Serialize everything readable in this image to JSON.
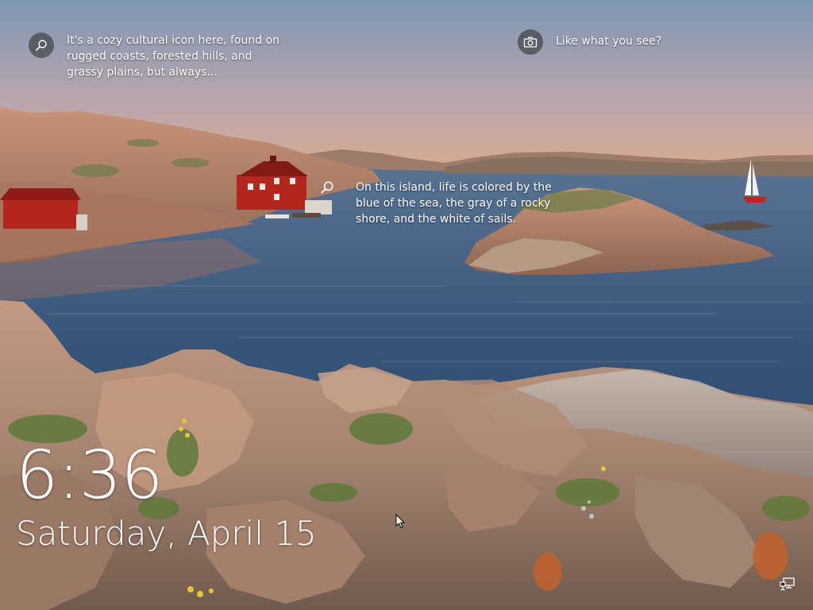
{
  "lock_screen": {
    "spotlight": {
      "top_left": {
        "icon": "search-icon",
        "text": "It's a cozy cultural icon here, found on rugged coasts, forested hills, and grassy plains, but always..."
      },
      "top_right": {
        "icon": "camera-icon",
        "text": "Like what you see?"
      },
      "island": {
        "icon": "search-icon",
        "text": "On this island, life is colored by the blue of the sea, the gray of a rocky shore, and the white of sails."
      }
    },
    "clock": {
      "time": "6:36",
      "date": "Saturday, April 15"
    },
    "tray": {
      "network_icon": "network-icon"
    }
  },
  "colors": {
    "sky_top": "#8a9cb5",
    "sky_bottom": "#d9a98e",
    "water": "#2e4b6d",
    "rock": "#b58770",
    "house_red": "#b5271e",
    "text": "#ffffff"
  }
}
